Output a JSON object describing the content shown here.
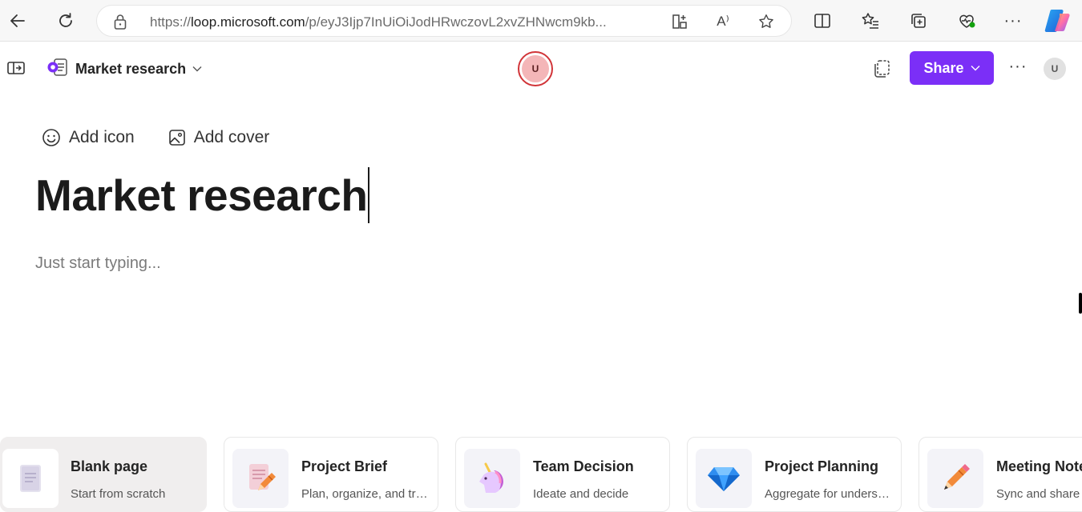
{
  "browser": {
    "url_prefix": "https://",
    "url_host": "loop.microsoft.com",
    "url_rest": "/p/eyJ3Ijp7InUiOiJodHRwczovL2xvZHNwcm9kb...",
    "read_aloud_label": "A⁾",
    "more_label": "···"
  },
  "app": {
    "page_name": "Market research",
    "presence_initial": "U",
    "share_label": "Share",
    "more_label": "···",
    "user_initial": "U"
  },
  "page": {
    "add_icon_label": "Add icon",
    "add_cover_label": "Add cover",
    "title": "Market research",
    "placeholder": "Just start typing..."
  },
  "templates": [
    {
      "title": "Blank page",
      "description": "Start from scratch",
      "icon": "blank-page-icon"
    },
    {
      "title": "Project Brief",
      "description": "Plan, organize, and track",
      "icon": "project-brief-icon"
    },
    {
      "title": "Team Decision",
      "description": "Ideate and decide",
      "icon": "unicorn-icon"
    },
    {
      "title": "Project Planning",
      "description": "Aggregate for understanding",
      "icon": "gem-icon"
    },
    {
      "title": "Meeting Notes",
      "description": "Sync and share",
      "icon": "pencil-icon"
    }
  ],
  "colors": {
    "accent": "#7b2ff7",
    "presence_ring": "#d13438"
  }
}
